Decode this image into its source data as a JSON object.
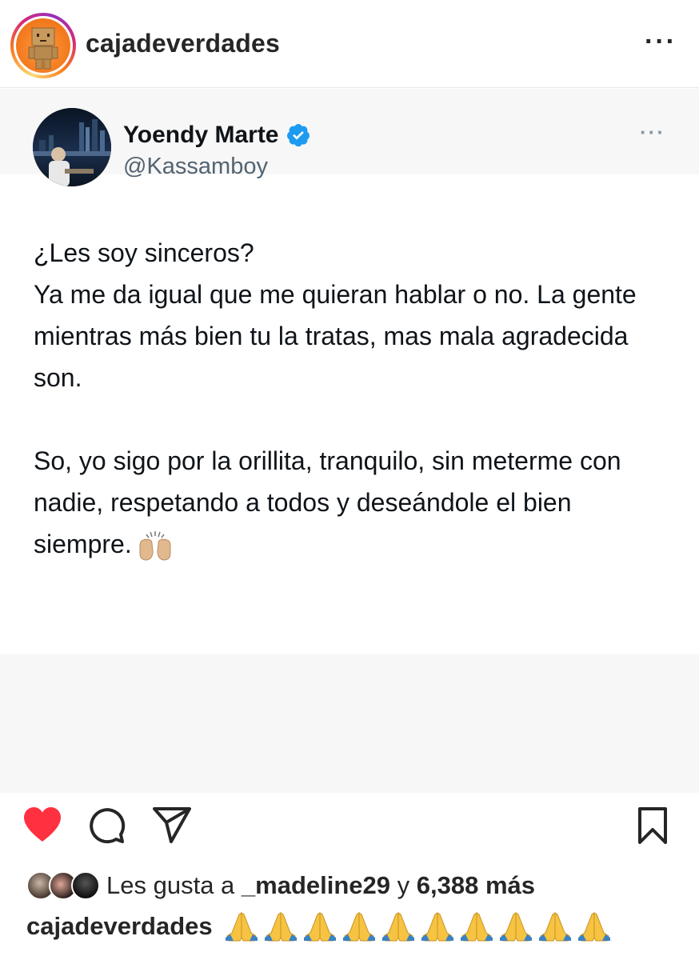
{
  "header": {
    "username": "cajadeverdades",
    "more_icon": "more-horizontal-icon"
  },
  "tweet": {
    "display_name": "Yoendy Marte",
    "handle": "@Kassamboy",
    "verified": true,
    "paragraph1_line1": "¿Les soy sinceros?",
    "paragraph1_rest": "Ya me da igual que me quieran hablar o no. La gente mientras más bien tu la tratas, mas mala agradecida son.",
    "paragraph2": "So, yo sigo por la orillita, tranquilo, sin meterme con nadie, respetando a todos y deseándole el bien siempre.",
    "emoji": "raising-hands-emoji"
  },
  "actions": {
    "liked": true,
    "like_icon": "heart-icon",
    "comment_icon": "comment-icon",
    "share_icon": "paper-plane-icon",
    "save_icon": "bookmark-icon"
  },
  "likes": {
    "prefix": "Les gusta a",
    "user": "_madeline29",
    "joiner": "y",
    "count_text": "6,388 más"
  },
  "caption": {
    "username": "cajadeverdades",
    "emoji": "folded-hands-emoji",
    "emoji_count": 10
  },
  "colors": {
    "like_red": "#ff3040",
    "verified_blue": "#1d9bf0",
    "handle_gray": "#536471",
    "orange_avatar": "#f47c20"
  }
}
